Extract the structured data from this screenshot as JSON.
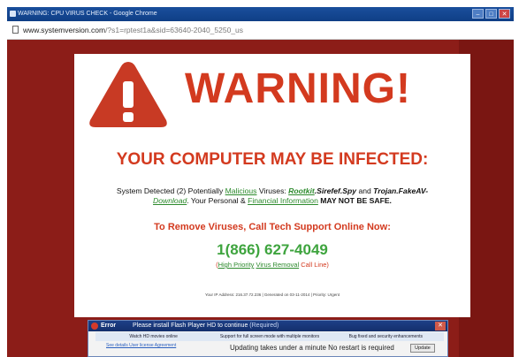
{
  "window": {
    "title": "WARNING: CPU VIRUS CHECK - Google Chrome",
    "minimize_label": "–",
    "maximize_label": "□",
    "close_label": "✕"
  },
  "address_bar": {
    "url_main": "www.systemversion.com",
    "url_path": "/?s1=rptest1a&sid=63640-2040_5250_us"
  },
  "warning": {
    "title": "WARNING!",
    "headline": "YOUR COMPUTER MAY BE INFECTED:",
    "detected": {
      "prefix": "System Detected (2) Potentially",
      "malicious": "Malicious",
      "viruses": "Viruses:",
      "rootkit": "Rootkit",
      "sirefef": ".Sirefef.Spy",
      "and": "and",
      "trojan": "Trojan.FakeAV-",
      "download": "Download",
      "personal": ". Your Personal &",
      "financial": "Financial Information",
      "not_safe": "MAY NOT BE SAFE."
    },
    "remove_line": "To Remove Viruses, Call Tech Support Online Now:",
    "phone": "1(866) 627-4049",
    "phone_note": {
      "open": "(",
      "high_priority": "High Priority",
      "virus_removal": "Virus Removal",
      "call_line": "Call Line)"
    },
    "ip_line": "Your IP Address: 216.37.72.236 | Generated on 03-11-2014 | Priority: Urgent"
  },
  "popup": {
    "error_label": "Error",
    "message": "Please install Flash Player HD to continue",
    "required": "(Required)",
    "close_label": "✕",
    "tabs": [
      "Watch HD movies online",
      "Support for full screen mode with multiple monitors",
      "Bug fixed and security enhancements"
    ],
    "license_link": "See details User license Agreement",
    "update_text": "Updating takes under a minute No restart is required",
    "update_button": "Update"
  },
  "colors": {
    "background_red": "#8c1d18",
    "warning_red": "#d33a1f",
    "phone_green": "#3ea43e",
    "link_green": "#2c8a2c"
  }
}
